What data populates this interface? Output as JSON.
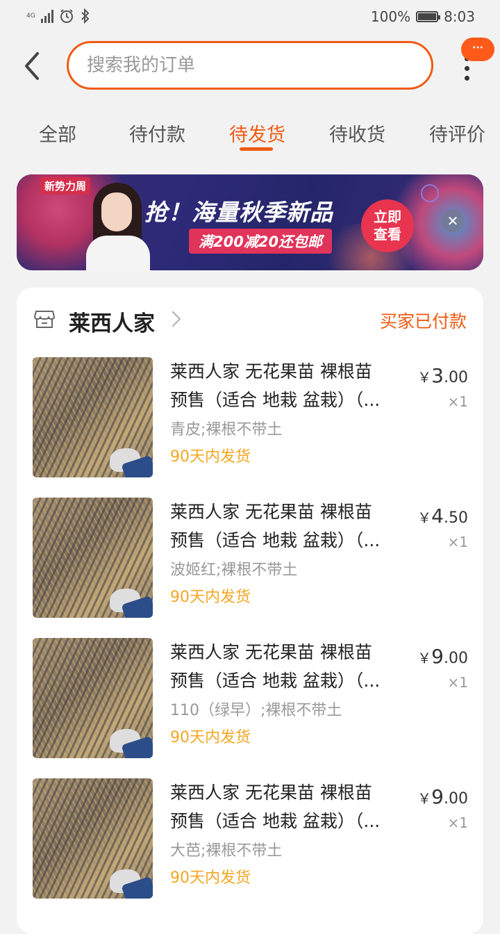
{
  "status_bar": {
    "network": "4G",
    "battery": "100%",
    "time": "8:03"
  },
  "header": {
    "search_placeholder": "搜索我的订单",
    "message_badge": "···"
  },
  "tabs": [
    {
      "label": "全部",
      "active": false
    },
    {
      "label": "待付款",
      "active": false
    },
    {
      "label": "待发货",
      "active": true
    },
    {
      "label": "待收货",
      "active": false
    },
    {
      "label": "待评价",
      "active": false
    }
  ],
  "banner": {
    "tag": "新势力周",
    "headline": "抢！海量秋季新品",
    "subline": "满200减20还包邮",
    "cta_line1": "立即",
    "cta_line2": "查看"
  },
  "order": {
    "shop_name": "莱西人家",
    "status": "买家已付款",
    "items": [
      {
        "title_line1": "莱西人家  无花果苗 裸根苗",
        "title_line2": "预售（适合 地栽 盆栽）（...",
        "sku": "青皮;裸根不带土",
        "shipping": "90天内发货",
        "price_currency": "￥",
        "price_int": "3",
        "price_dec": ".00",
        "qty": "×1"
      },
      {
        "title_line1": "莱西人家  无花果苗 裸根苗",
        "title_line2": "预售（适合 地栽 盆栽）（...",
        "sku": "波姬红;裸根不带土",
        "shipping": "90天内发货",
        "price_currency": "￥",
        "price_int": "4",
        "price_dec": ".50",
        "qty": "×1"
      },
      {
        "title_line1": "莱西人家  无花果苗 裸根苗",
        "title_line2": "预售（适合 地栽 盆栽）（...",
        "sku": "110（绿早）;裸根不带土",
        "shipping": "90天内发货",
        "price_currency": "￥",
        "price_int": "9",
        "price_dec": ".00",
        "qty": "×1"
      },
      {
        "title_line1": "莱西人家  无花果苗 裸根苗",
        "title_line2": "预售（适合 地栽 盆栽）（...",
        "sku": "大芭;裸根不带土",
        "shipping": "90天内发货",
        "price_currency": "￥",
        "price_int": "9",
        "price_dec": ".00",
        "qty": "×1"
      }
    ]
  },
  "colors": {
    "accent": "#f05a12",
    "shipping_text": "#f5a623",
    "background": "#f2f2f2"
  }
}
